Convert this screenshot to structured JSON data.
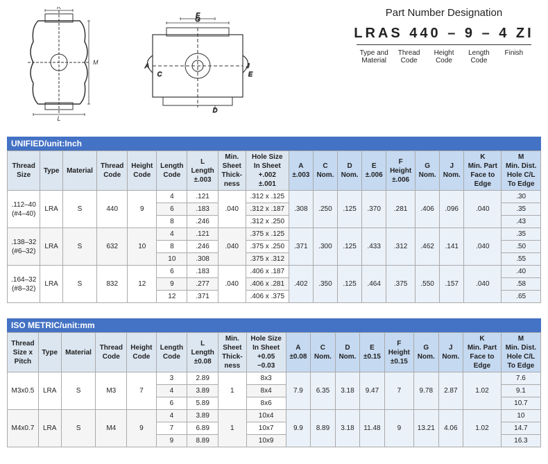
{
  "diagrams": {
    "left_alt": "Front view bolt diagram with K, M, L labels",
    "right_alt": "Side cross-section diagram with G, F, A, C, J, E, D labels"
  },
  "part_number": {
    "title": "Part Number Designation",
    "code": "LRAS  440  –  9  –  4  ZI",
    "labels": [
      "Type and\nMaterial",
      "Thread\nCode",
      "Height\nCode",
      "Length\nCode",
      "Finish"
    ]
  },
  "unified": {
    "section_title": "UNIFIED/unit:Inch",
    "columns": [
      "Thread\nSize",
      "Type",
      "Material",
      "Thread\nCode",
      "Height\nCode",
      "Length\nCode",
      "L\nLength\n±.003",
      "Min.\nSheet\nThick-\nness",
      "Hole Size\nIn Sheet\n+.002\n±.001",
      "A\n±.003",
      "C\nNom.",
      "D\nNom.",
      "E\n±.006",
      "F\nHeight\n±.006",
      "G\nNom.",
      "J\nNom.",
      "K\nMin. Part\nFace to\nEdge",
      "M\nMin. Dist.\nHole C/L\nTo Edge"
    ],
    "rows": [
      {
        "thread_size": ".112–40\n(#4–40)",
        "type": "LRA",
        "material": "S",
        "thread_code": "440",
        "height_code": "9",
        "length_codes": [
          "4",
          "6",
          "8"
        ],
        "lengths": [
          ".121",
          ".183",
          ".246"
        ],
        "min_sheet": ".040",
        "hole_sizes": [
          ".312 x .125",
          ".312 x .187",
          ".312 x .250"
        ],
        "A": ".308",
        "C": ".250",
        "D": ".125",
        "E": ".370",
        "F": ".281",
        "G": ".406",
        "J": ".096",
        "K": ".040",
        "M_vals": [
          ".30",
          ".35",
          ".43"
        ]
      },
      {
        "thread_size": ".138–32\n(#6–32)",
        "type": "LRA",
        "material": "S",
        "thread_code": "632",
        "height_code": "10",
        "length_codes": [
          "4",
          "8",
          "10"
        ],
        "lengths": [
          ".121",
          ".246",
          ".308"
        ],
        "min_sheet": ".040",
        "hole_sizes": [
          ".375 x .125",
          ".375 x .250",
          ".375 x .312"
        ],
        "A": ".371",
        "C": ".300",
        "D": ".125",
        "E": ".433",
        "F": ".312",
        "G": ".462",
        "J": ".141",
        "K": ".040",
        "M_vals": [
          ".35",
          ".50",
          ".55"
        ]
      },
      {
        "thread_size": ".164–32\n(#8–32)",
        "type": "LRA",
        "material": "S",
        "thread_code": "832",
        "height_code": "12",
        "length_codes": [
          "6",
          "9",
          "12"
        ],
        "lengths": [
          ".183",
          ".277",
          ".371"
        ],
        "min_sheet": ".040",
        "hole_sizes": [
          ".406 x .187",
          ".406 x .281",
          ".406 x .375"
        ],
        "A": ".402",
        "C": ".350",
        "D": ".125",
        "E": ".464",
        "F": ".375",
        "G": ".550",
        "J": ".157",
        "K": ".040",
        "M_vals": [
          ".40",
          ".58",
          ".65"
        ]
      }
    ]
  },
  "iso": {
    "section_title": "ISO METRIC/unit:mm",
    "columns": [
      "Thread\nSize x\nPitch",
      "Type",
      "Material",
      "Thread\nCode",
      "Height\nCode",
      "Length\nCode",
      "L\nLength\n±0.08",
      "Min.\nSheet\nThick-\nness",
      "Hole Size\nIn Sheet\n+0.05\n−0.03",
      "A\n±0.08",
      "C\nNom.",
      "D\nNom.",
      "E\n±0.15",
      "F\nHeight\n±0.15",
      "G\nNom.",
      "J\nNom.",
      "K\nMin. Part\nFace to\nEdge",
      "M\nMin. Dist.\nHole C/L\nTo Edge"
    ],
    "rows": [
      {
        "thread_size": "M3x0.5",
        "type": "LRA",
        "material": "S",
        "thread_code": "M3",
        "height_code": "7",
        "length_codes": [
          "3",
          "4",
          "6"
        ],
        "lengths": [
          "2.89",
          "3.89",
          "5.89"
        ],
        "min_sheet": "1",
        "hole_sizes": [
          "8x3",
          "8x4",
          "8x6"
        ],
        "A": "7.9",
        "C": "6.35",
        "D": "3.18",
        "E": "9.47",
        "F": "7",
        "G": "9.78",
        "J": "2.87",
        "K": "1.02",
        "M_vals": [
          "7.6",
          "9.1",
          "10.7"
        ]
      },
      {
        "thread_size": "M4x0.7",
        "type": "LRA",
        "material": "S",
        "thread_code": "M4",
        "height_code": "9",
        "length_codes": [
          "4",
          "7",
          "9"
        ],
        "lengths": [
          "3.89",
          "6.89",
          "8.89"
        ],
        "min_sheet": "1",
        "hole_sizes": [
          "10x4",
          "10x7",
          "10x9"
        ],
        "A": "9.9",
        "C": "8.89",
        "D": "3.18",
        "E": "11.48",
        "F": "9",
        "G": "13.21",
        "J": "4.06",
        "K": "1.02",
        "M_vals": [
          "10",
          "14.7",
          "16.3"
        ]
      }
    ]
  }
}
